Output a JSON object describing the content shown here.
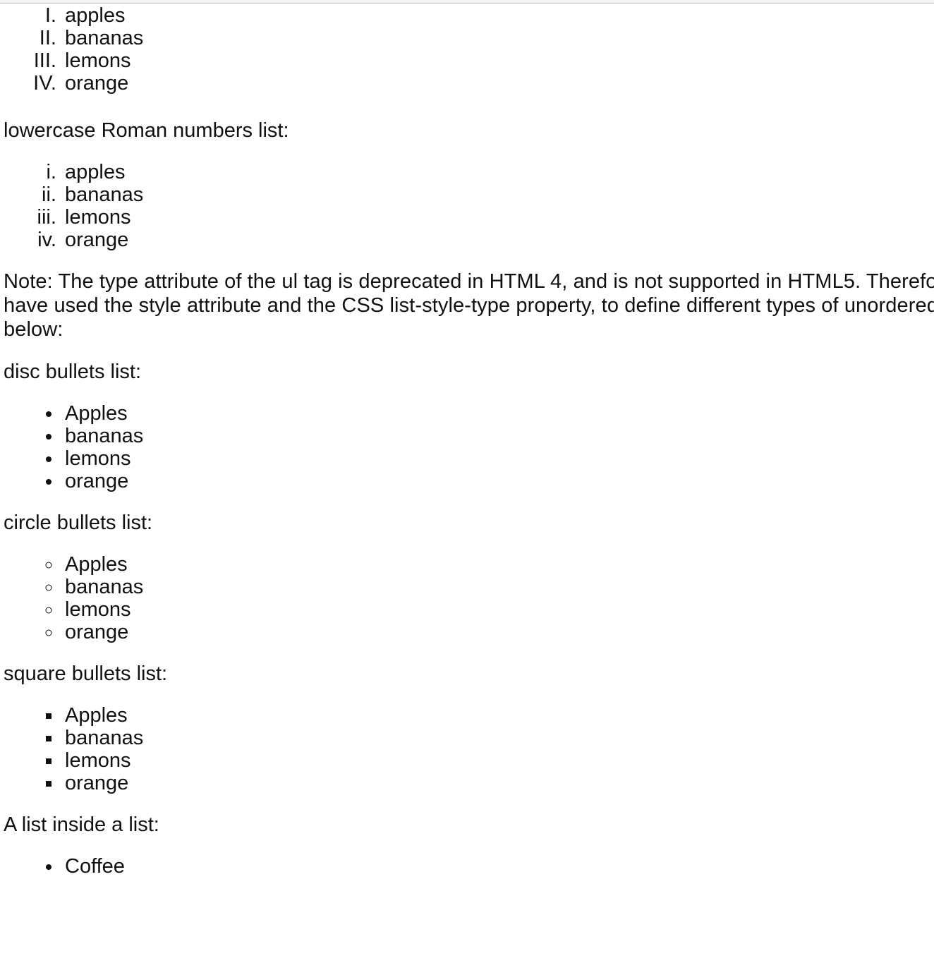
{
  "document": {
    "blocks": [
      {
        "kind": "list",
        "name": "upper-roman-list",
        "marker": "upper-roman",
        "items": [
          "apples",
          "bananas",
          "lemons",
          "orange"
        ]
      },
      {
        "kind": "gap",
        "size": "gap-lg"
      },
      {
        "kind": "heading",
        "name": "heading-lowercase-roman",
        "text": "lowercase Roman numbers list:"
      },
      {
        "kind": "gap",
        "size": "gap-md"
      },
      {
        "kind": "list",
        "name": "lower-roman-list",
        "marker": "lower-roman",
        "items": [
          "apples",
          "bananas",
          "lemons",
          "orange"
        ]
      },
      {
        "kind": "gap",
        "size": "gap-md"
      },
      {
        "kind": "paragraph",
        "name": "note-paragraph",
        "text": "Note: The type attribute of the ul tag is deprecated in HTML 4, and is not supported in HTML5. Therefore we have used the style attribute and the CSS list-style-type property, to define different types of unordered lists below:"
      },
      {
        "kind": "gap",
        "size": "gap-md"
      },
      {
        "kind": "heading",
        "name": "heading-disc-bullets",
        "text": "disc bullets list:"
      },
      {
        "kind": "gap",
        "size": "gap-md"
      },
      {
        "kind": "list",
        "name": "disc-bullets-list",
        "marker": "disc",
        "items": [
          "Apples",
          "bananas",
          "lemons",
          "orange"
        ]
      },
      {
        "kind": "gap",
        "size": "gap-md"
      },
      {
        "kind": "heading",
        "name": "heading-circle-bullets",
        "text": "circle bullets list:"
      },
      {
        "kind": "gap",
        "size": "gap-md"
      },
      {
        "kind": "list",
        "name": "circle-bullets-list",
        "marker": "circle",
        "items": [
          "Apples",
          "bananas",
          "lemons",
          "orange"
        ]
      },
      {
        "kind": "gap",
        "size": "gap-md"
      },
      {
        "kind": "heading",
        "name": "heading-square-bullets",
        "text": "square bullets list:"
      },
      {
        "kind": "gap",
        "size": "gap-md"
      },
      {
        "kind": "list",
        "name": "square-bullets-list",
        "marker": "square",
        "items": [
          "Apples",
          "bananas",
          "lemons",
          "orange"
        ]
      },
      {
        "kind": "gap",
        "size": "gap-md"
      },
      {
        "kind": "heading",
        "name": "heading-nested-list",
        "text": "A list inside a list:"
      },
      {
        "kind": "gap",
        "size": "gap-md"
      },
      {
        "kind": "list",
        "name": "nested-outer-list",
        "marker": "disc",
        "items": [
          "Coffee"
        ]
      }
    ]
  },
  "colors": {
    "page_background": "#ffffff",
    "text": "#111111",
    "chrome_strip": "#f2f2f2",
    "chrome_border": "#b8b8b8"
  }
}
